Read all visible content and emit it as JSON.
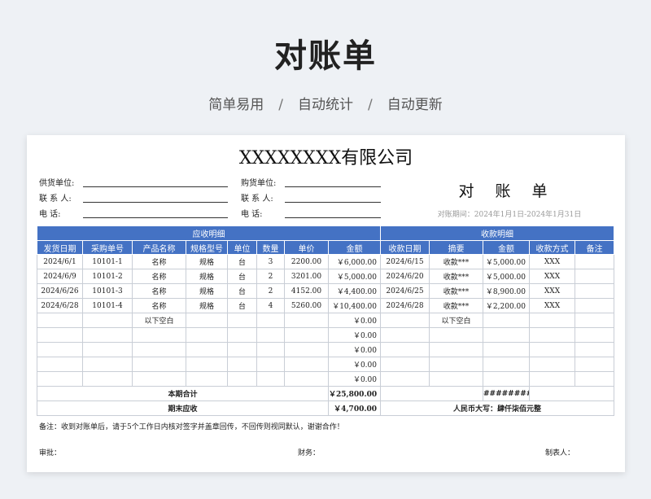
{
  "hero": {
    "title": "对账单",
    "tags": [
      "简单易用",
      "自动统计",
      "自动更新"
    ],
    "sep": "/"
  },
  "doc": {
    "company": "XXXXXXXX有限公司",
    "left_fields": [
      "供货单位:",
      "联 系 人:",
      "电      话:"
    ],
    "right_fields": [
      "购货单位:",
      "联 系 人:",
      "电      话:"
    ],
    "title": "对 账 单",
    "period": "对账期间：2024年1月1日-2024年1月31日"
  },
  "table": {
    "section_recv": "应收明细",
    "section_paid": "收款明细",
    "headers": [
      "发货日期",
      "采购单号",
      "产品名称",
      "规格型号",
      "单位",
      "数量",
      "单价",
      "金额",
      "收款日期",
      "摘要",
      "金额",
      "收款方式",
      "备注"
    ],
    "rows": [
      [
        "2024/6/1",
        "10101-1",
        "名称",
        "规格",
        "台",
        "3",
        "2200.00",
        "￥6,000.00",
        "2024/6/15",
        "收款***",
        "￥5,000.00",
        "XXX",
        ""
      ],
      [
        "2024/6/9",
        "10101-2",
        "名称",
        "规格",
        "台",
        "2",
        "3201.00",
        "￥5,000.00",
        "2024/6/20",
        "收款***",
        "￥5,000.00",
        "XXX",
        ""
      ],
      [
        "2024/6/26",
        "10101-3",
        "名称",
        "规格",
        "台",
        "2",
        "4152.00",
        "￥4,400.00",
        "2024/6/25",
        "收款***",
        "￥8,900.00",
        "XXX",
        ""
      ],
      [
        "2024/6/28",
        "10101-4",
        "名称",
        "规格",
        "台",
        "4",
        "5260.00",
        "￥10,400.00",
        "2024/6/28",
        "收款***",
        "￥2,200.00",
        "XXX",
        ""
      ],
      [
        "",
        "",
        "以下空白",
        "",
        "",
        "",
        "",
        "￥0.00",
        "",
        "以下空白",
        "",
        "",
        ""
      ],
      [
        "",
        "",
        "",
        "",
        "",
        "",
        "",
        "￥0.00",
        "",
        "",
        "",
        "",
        ""
      ],
      [
        "",
        "",
        "",
        "",
        "",
        "",
        "",
        "￥0.00",
        "",
        "",
        "",
        "",
        ""
      ],
      [
        "",
        "",
        "",
        "",
        "",
        "",
        "",
        "￥0.00",
        "",
        "",
        "",
        "",
        ""
      ],
      [
        "",
        "",
        "",
        "",
        "",
        "",
        "",
        "￥0.00",
        "",
        "",
        "",
        "",
        ""
      ]
    ],
    "total_label": "本期合计",
    "total_amount": "￥25,800.00",
    "total_paid": "##########",
    "closing_label": "期末应收",
    "closing_amount": "￥4,700.00",
    "closing_words": "人民币大写：肆仟柒佰元整"
  },
  "footer": {
    "note": "备注：收到对账单后，请于5个工作日内核对签字并盖章回传，不回传则视同默认，谢谢合作！",
    "approve": "审批：",
    "finance": "财务：",
    "maker": "制表人："
  }
}
